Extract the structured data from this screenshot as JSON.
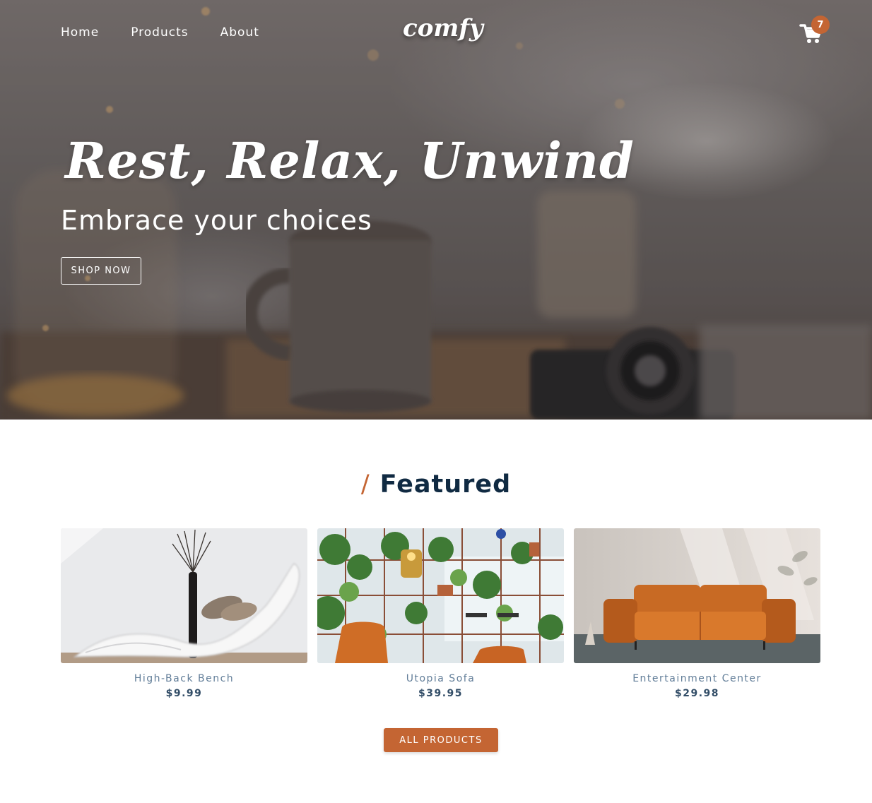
{
  "nav": {
    "links": [
      {
        "label": "Home"
      },
      {
        "label": "Products"
      },
      {
        "label": "About"
      }
    ],
    "logo": "comfy",
    "cart_count": "7",
    "cart_icon": "shopping-cart-icon"
  },
  "hero": {
    "title": "Rest, Relax, Unwind",
    "subtitle": "Embrace your choices",
    "cta_label": "SHOP NOW"
  },
  "featured": {
    "title": "Featured",
    "slash": "/",
    "products": [
      {
        "name": "High-Back Bench",
        "price": "$9.99"
      },
      {
        "name": "Utopia Sofa",
        "price": "$39.95"
      },
      {
        "name": "Entertainment Center",
        "price": "$29.98"
      }
    ],
    "all_products_label": "ALL PRODUCTS"
  },
  "colors": {
    "accent": "#c46533",
    "heading": "#102a42",
    "product_name": "#617d98",
    "product_price": "#324d67"
  }
}
